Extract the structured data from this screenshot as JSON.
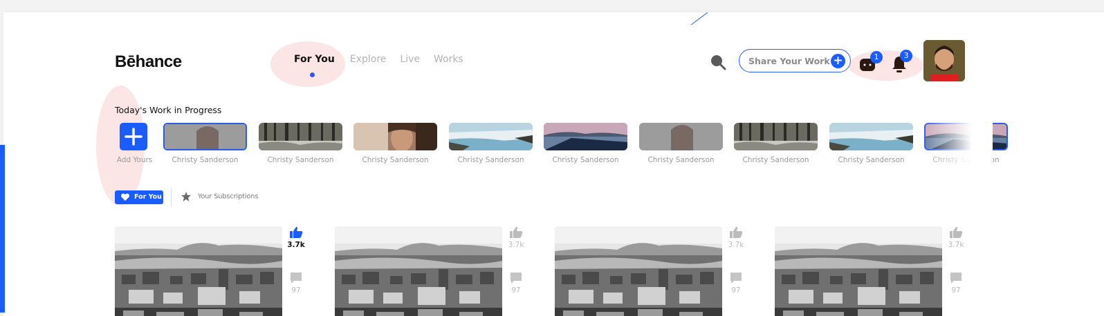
{
  "brand": {
    "logo": "Bēhance",
    "accent": "#1a5cff"
  },
  "nav": {
    "items": [
      {
        "label": "For You",
        "active": true
      },
      {
        "label": "Explore",
        "active": false
      },
      {
        "label": "Live",
        "active": false
      },
      {
        "label": "Works",
        "active": false
      }
    ]
  },
  "header": {
    "share_label": "Share Your Work",
    "share_icon": "plus-icon",
    "messages_badge": "1",
    "notifications_badge": "3"
  },
  "wip": {
    "title": "Today's Work in Progress",
    "add_label": "Add Yours",
    "stories": [
      {
        "name": "Christy Sanderson",
        "thumb": "portrait"
      },
      {
        "name": "Christy Sanderson",
        "thumb": "forest"
      },
      {
        "name": "Christy Sanderson",
        "thumb": "portrait-color"
      },
      {
        "name": "Christy Sanderson",
        "thumb": "waterfall"
      },
      {
        "name": "Christy Sanderson",
        "thumb": "lake"
      },
      {
        "name": "Christy Sanderson",
        "thumb": "portrait"
      },
      {
        "name": "Christy Sanderson",
        "thumb": "forest"
      },
      {
        "name": "Christy Sanderson",
        "thumb": "waterfall"
      },
      {
        "name": "Christy Sanderson",
        "thumb": "lake"
      }
    ]
  },
  "feed_tabs": {
    "for_you": "For You",
    "subscriptions": "Your Subscriptions"
  },
  "posts": [
    {
      "likes": "3.7k",
      "comments": "97",
      "liked": true
    },
    {
      "likes": "3.7k",
      "comments": "97",
      "liked": false
    },
    {
      "likes": "3.7k",
      "comments": "97",
      "liked": false
    },
    {
      "likes": "3.7k",
      "comments": "97",
      "liked": false
    }
  ]
}
